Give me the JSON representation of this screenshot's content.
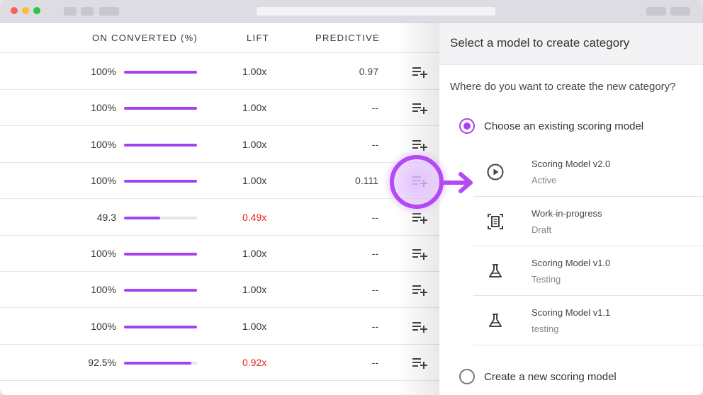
{
  "colors": {
    "accent": "#a342f0",
    "negative": "#e8231f"
  },
  "table": {
    "headers": {
      "converted": "ON CONVERTED (%)",
      "lift": "LIFT",
      "predictive": "PREDICTIVE"
    },
    "rows": [
      {
        "pct": "100%",
        "fill": 1.0,
        "lift": "1.00x",
        "pred": "0.97"
      },
      {
        "pct": "100%",
        "fill": 1.0,
        "lift": "1.00x",
        "pred": "--"
      },
      {
        "pct": "100%",
        "fill": 1.0,
        "lift": "1.00x",
        "pred": "--"
      },
      {
        "pct": "100%",
        "fill": 1.0,
        "lift": "1.00x",
        "pred": "0.111"
      },
      {
        "pct": "49.3",
        "fill": 0.493,
        "lift": "0.49x",
        "pred": "--",
        "neg": true
      },
      {
        "pct": "100%",
        "fill": 1.0,
        "lift": "1.00x",
        "pred": "--"
      },
      {
        "pct": "100%",
        "fill": 1.0,
        "lift": "1.00x",
        "pred": "--"
      },
      {
        "pct": "100%",
        "fill": 1.0,
        "lift": "1.00x",
        "pred": "--"
      },
      {
        "pct": "92.5%",
        "fill": 0.925,
        "lift": "0.92x",
        "pred": "--",
        "neg": true
      }
    ],
    "action_icon": "add-to-list-icon"
  },
  "panel": {
    "title": "Select a model to create category",
    "question": "Where do you want to create the new category?",
    "option_existing": "Choose an existing scoring model",
    "option_new": "Create a new scoring model",
    "models": [
      {
        "name": "Scoring Model v2.0",
        "status": "Active",
        "icon": "play-circle-icon"
      },
      {
        "name": "Work-in-progress",
        "status": "Draft",
        "icon": "document-frame-icon"
      },
      {
        "name": "Scoring Model v1.0",
        "status": "Testing",
        "icon": "flask-icon"
      },
      {
        "name": "Scoring Model v1.1",
        "status": "testing",
        "icon": "flask-icon"
      }
    ]
  }
}
